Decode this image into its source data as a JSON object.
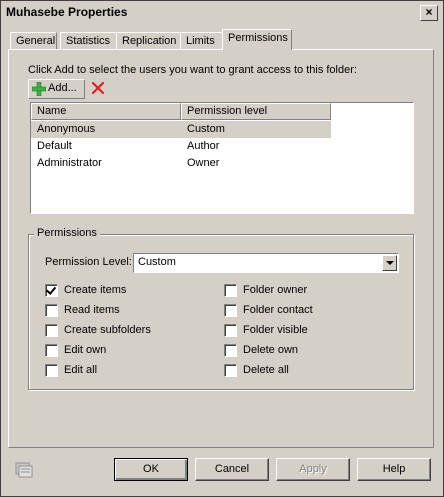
{
  "window": {
    "title": "Muhasebe Properties",
    "close_label": "×"
  },
  "tabs": [
    {
      "label": "General"
    },
    {
      "label": "Statistics"
    },
    {
      "label": "Replication"
    },
    {
      "label": "Limits"
    },
    {
      "label": "Permissions",
      "active": true
    }
  ],
  "instructions": "Click Add to select the users you want to grant access to this folder:",
  "toolbar": {
    "add_label": "Add..."
  },
  "listview": {
    "columns": [
      "Name",
      "Permission level"
    ],
    "rows": [
      {
        "name": "Anonymous",
        "level": "Custom",
        "selected": true
      },
      {
        "name": "Default",
        "level": "Author"
      },
      {
        "name": "Administrator",
        "level": "Owner"
      }
    ]
  },
  "permissions": {
    "group_label": "Permissions",
    "level_label": "Permission Level:",
    "level_value": "Custom",
    "left": [
      {
        "label": "Create items",
        "checked": true
      },
      {
        "label": "Read items",
        "checked": false
      },
      {
        "label": "Create subfolders",
        "checked": false
      },
      {
        "label": "Edit own",
        "checked": false
      },
      {
        "label": "Edit all",
        "checked": false
      }
    ],
    "right": [
      {
        "label": "Folder owner",
        "checked": false
      },
      {
        "label": "Folder contact",
        "checked": false
      },
      {
        "label": "Folder visible",
        "checked": false
      },
      {
        "label": "Delete own",
        "checked": false
      },
      {
        "label": "Delete all",
        "checked": false
      }
    ]
  },
  "buttons": {
    "ok": "OK",
    "cancel": "Cancel",
    "apply": "Apply",
    "help": "Help"
  },
  "colors": {
    "face": "#d4d0c8",
    "add_green": "#3cb043",
    "remove_red": "#e02020"
  }
}
